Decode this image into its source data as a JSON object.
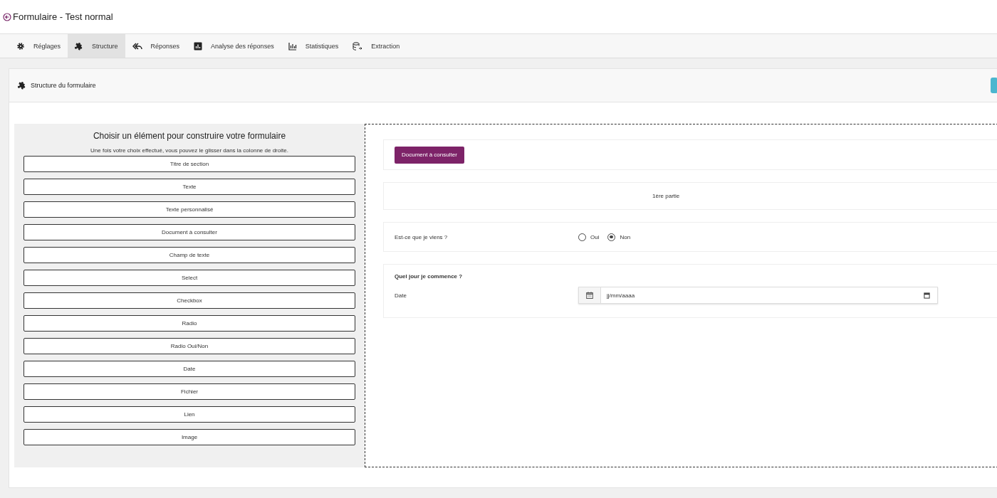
{
  "header": {
    "title": "Formulaire - Test normal"
  },
  "tabs": [
    {
      "label": "Réglages",
      "selected": false
    },
    {
      "label": "Structure",
      "selected": true
    },
    {
      "label": "Réponses",
      "selected": false
    },
    {
      "label": "Analyse des réponses",
      "selected": false
    },
    {
      "label": "Statistiques",
      "selected": false
    },
    {
      "label": "Extraction",
      "selected": false
    }
  ],
  "card": {
    "title": "Structure du formulaire"
  },
  "palette": {
    "title": "Choisir un élément pour construire votre formulaire",
    "hint": "Une fois votre choix effectué, vous pouvez le glisser dans la colonne de droite.",
    "items": [
      "Titre de section",
      "Texte",
      "Texte personnalisé",
      "Document à consulter",
      "Champ de texte",
      "Select",
      "Checkbox",
      "Radio",
      "Radio Oui/Non",
      "Date",
      "Fichier",
      "Lien",
      "Image"
    ]
  },
  "form": [
    {
      "kind": "document",
      "label": "Document à consulter"
    },
    {
      "kind": "section",
      "label": "1ère partie"
    },
    {
      "kind": "yesno",
      "label": "Est-ce que je viens ?",
      "options": [
        {
          "label": "Oui",
          "selected": false
        },
        {
          "label": "Non",
          "selected": true
        }
      ]
    },
    {
      "kind": "date",
      "title": "Quel jour je commence ?",
      "label": "Date",
      "placeholder": "jj/mm/aaaa"
    }
  ]
}
